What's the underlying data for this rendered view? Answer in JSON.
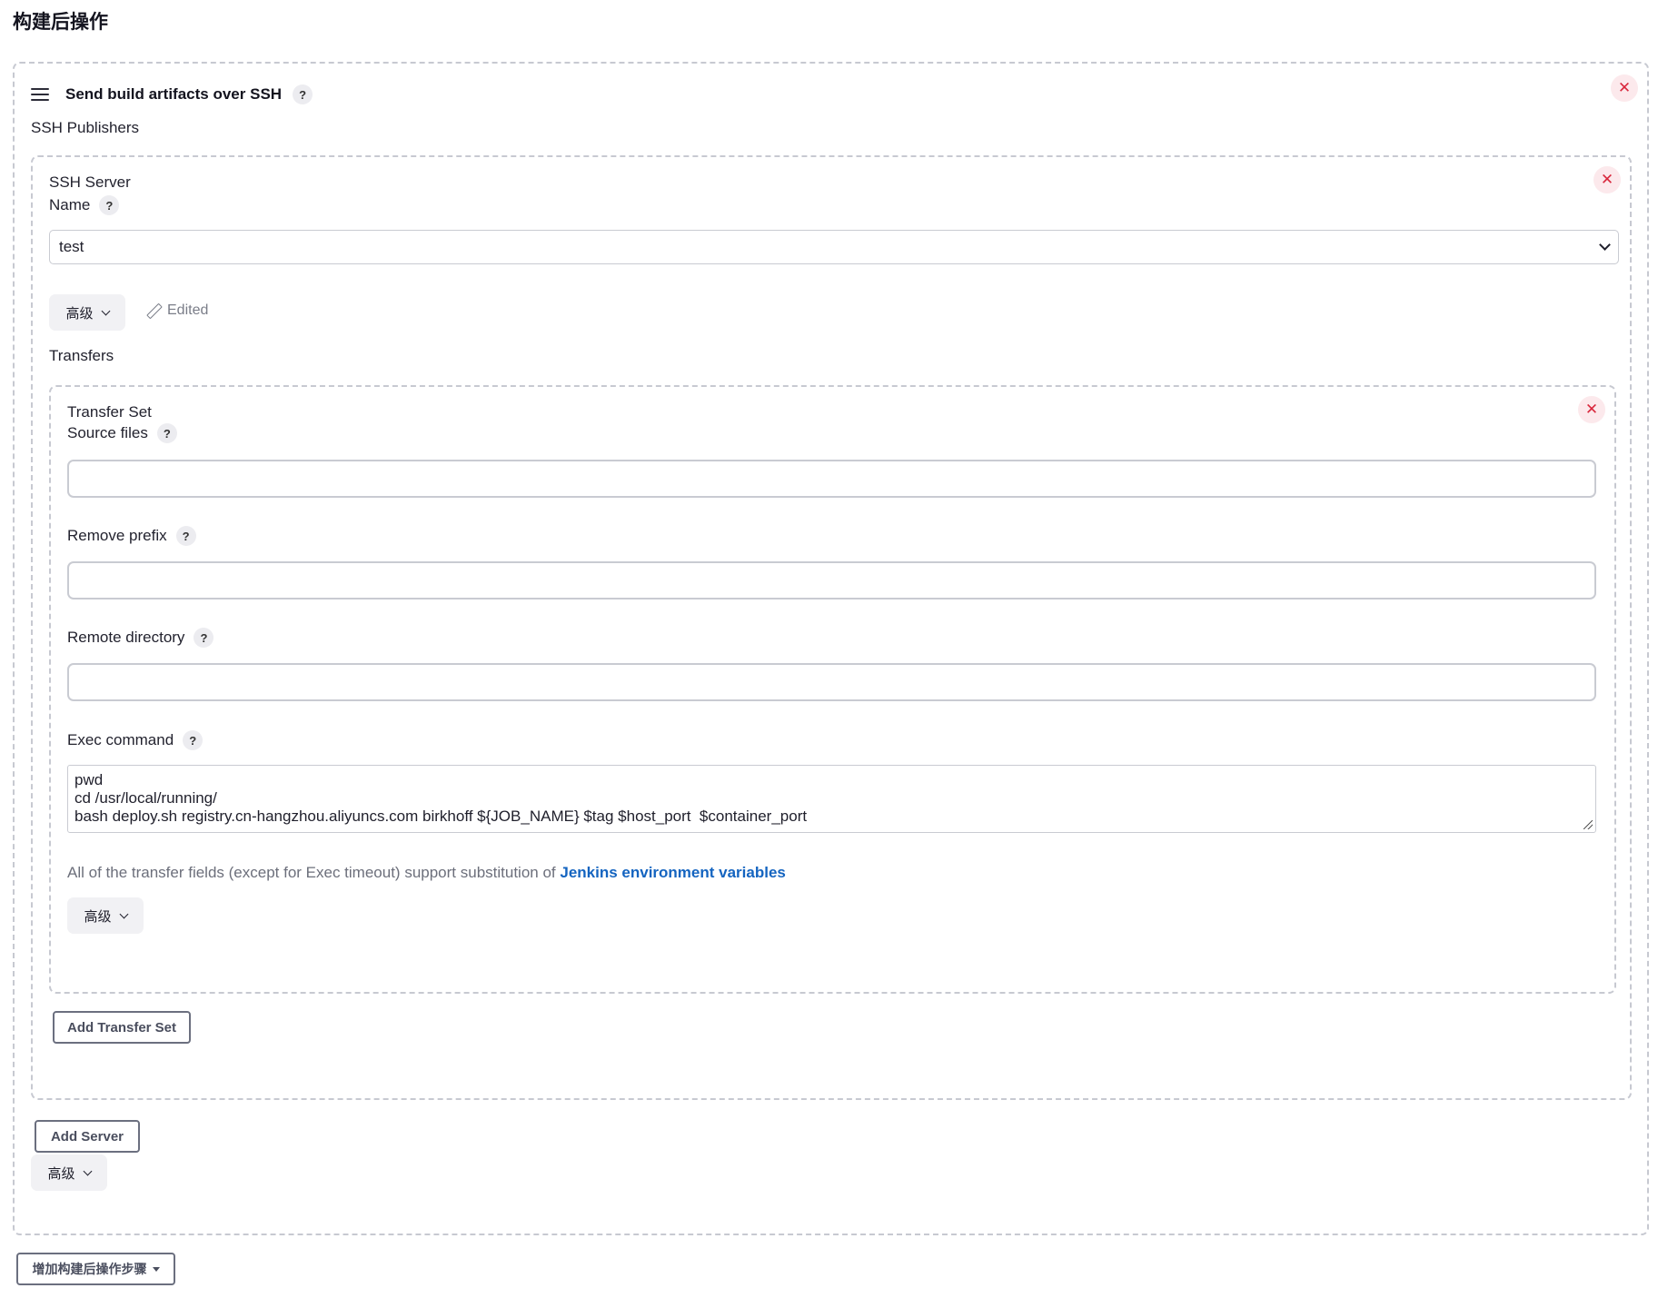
{
  "section": {
    "title": "构建后操作"
  },
  "publisher": {
    "title": "Send build artifacts over SSH",
    "subtitle": "SSH Publishers",
    "help_glyph": "?",
    "remove_glyph": "✕"
  },
  "server": {
    "heading": "SSH Server",
    "name_label": "Name",
    "name_value": "test",
    "advanced_label": "高级",
    "edited_label": "Edited",
    "transfers_label": "Transfers"
  },
  "transfer_set": {
    "heading": "Transfer Set",
    "source_files_label": "Source files",
    "source_files_value": "",
    "remove_prefix_label": "Remove prefix",
    "remove_prefix_value": "",
    "remote_directory_label": "Remote directory",
    "remote_directory_value": "",
    "exec_command_label": "Exec command",
    "exec_command_lines": [
      "pwd",
      "cd /usr/local/running/",
      "bash deploy.sh registry.cn-hangzhou.aliyuncs.com birkhoff ${JOB_NAME} $tag $host_port  $container_port"
    ],
    "hint_text": "All of the transfer fields (except for Exec timeout) support substitution of ",
    "hint_link": "Jenkins environment variables",
    "advanced_label": "高级"
  },
  "buttons": {
    "add_transfer_set": "Add Transfer Set",
    "add_server": "Add Server",
    "publisher_advanced": "高级",
    "add_post_build_step": "增加构建后操作步骤"
  },
  "icons": {
    "drag": "drag-handle-icon",
    "help": "help-icon",
    "close": "close-icon",
    "chevron": "chevron-down-icon",
    "pencil": "pencil-icon",
    "caret": "caret-down-icon"
  },
  "colors": {
    "link": "#1464c0",
    "remove_bg": "#fce9ec",
    "remove_fg": "#d9283d",
    "dashed_border": "#c7c9d1"
  }
}
